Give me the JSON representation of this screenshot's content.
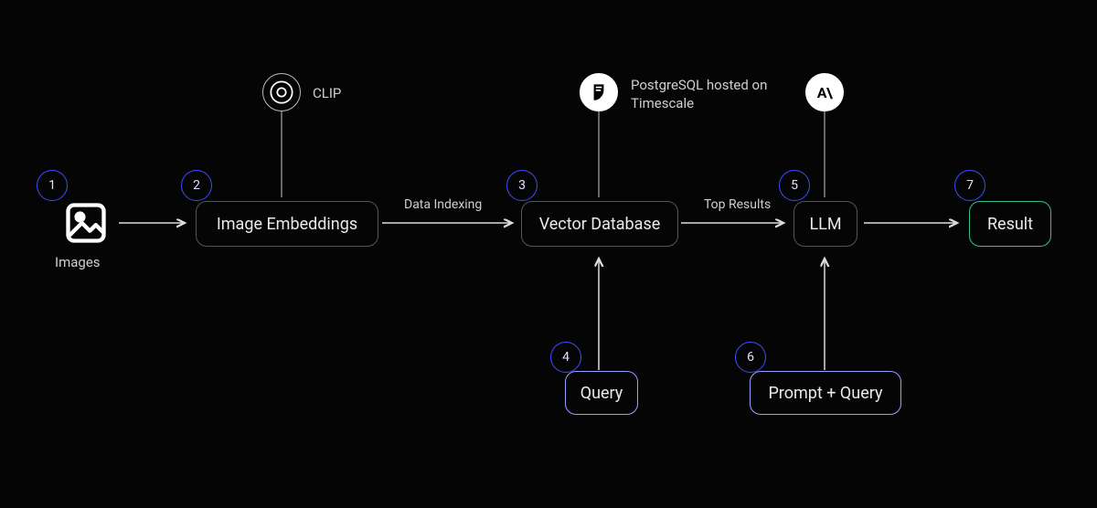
{
  "badges": {
    "n1": "1",
    "n2": "2",
    "n3": "3",
    "n4": "4",
    "n5": "5",
    "n6": "6",
    "n7": "7"
  },
  "nodes": {
    "images_caption": "Images",
    "embeddings": "Image Embeddings",
    "vectordb": "Vector Database",
    "llm": "LLM",
    "result": "Result",
    "query": "Query",
    "prompt_query": "Prompt + Query"
  },
  "icon_labels": {
    "clip": "CLIP",
    "pg": "PostgreSQL hosted on Timescale"
  },
  "edge_labels": {
    "indexing": "Data Indexing",
    "top": "Top Results"
  },
  "icon_text": {
    "anthropic": "A\\"
  }
}
